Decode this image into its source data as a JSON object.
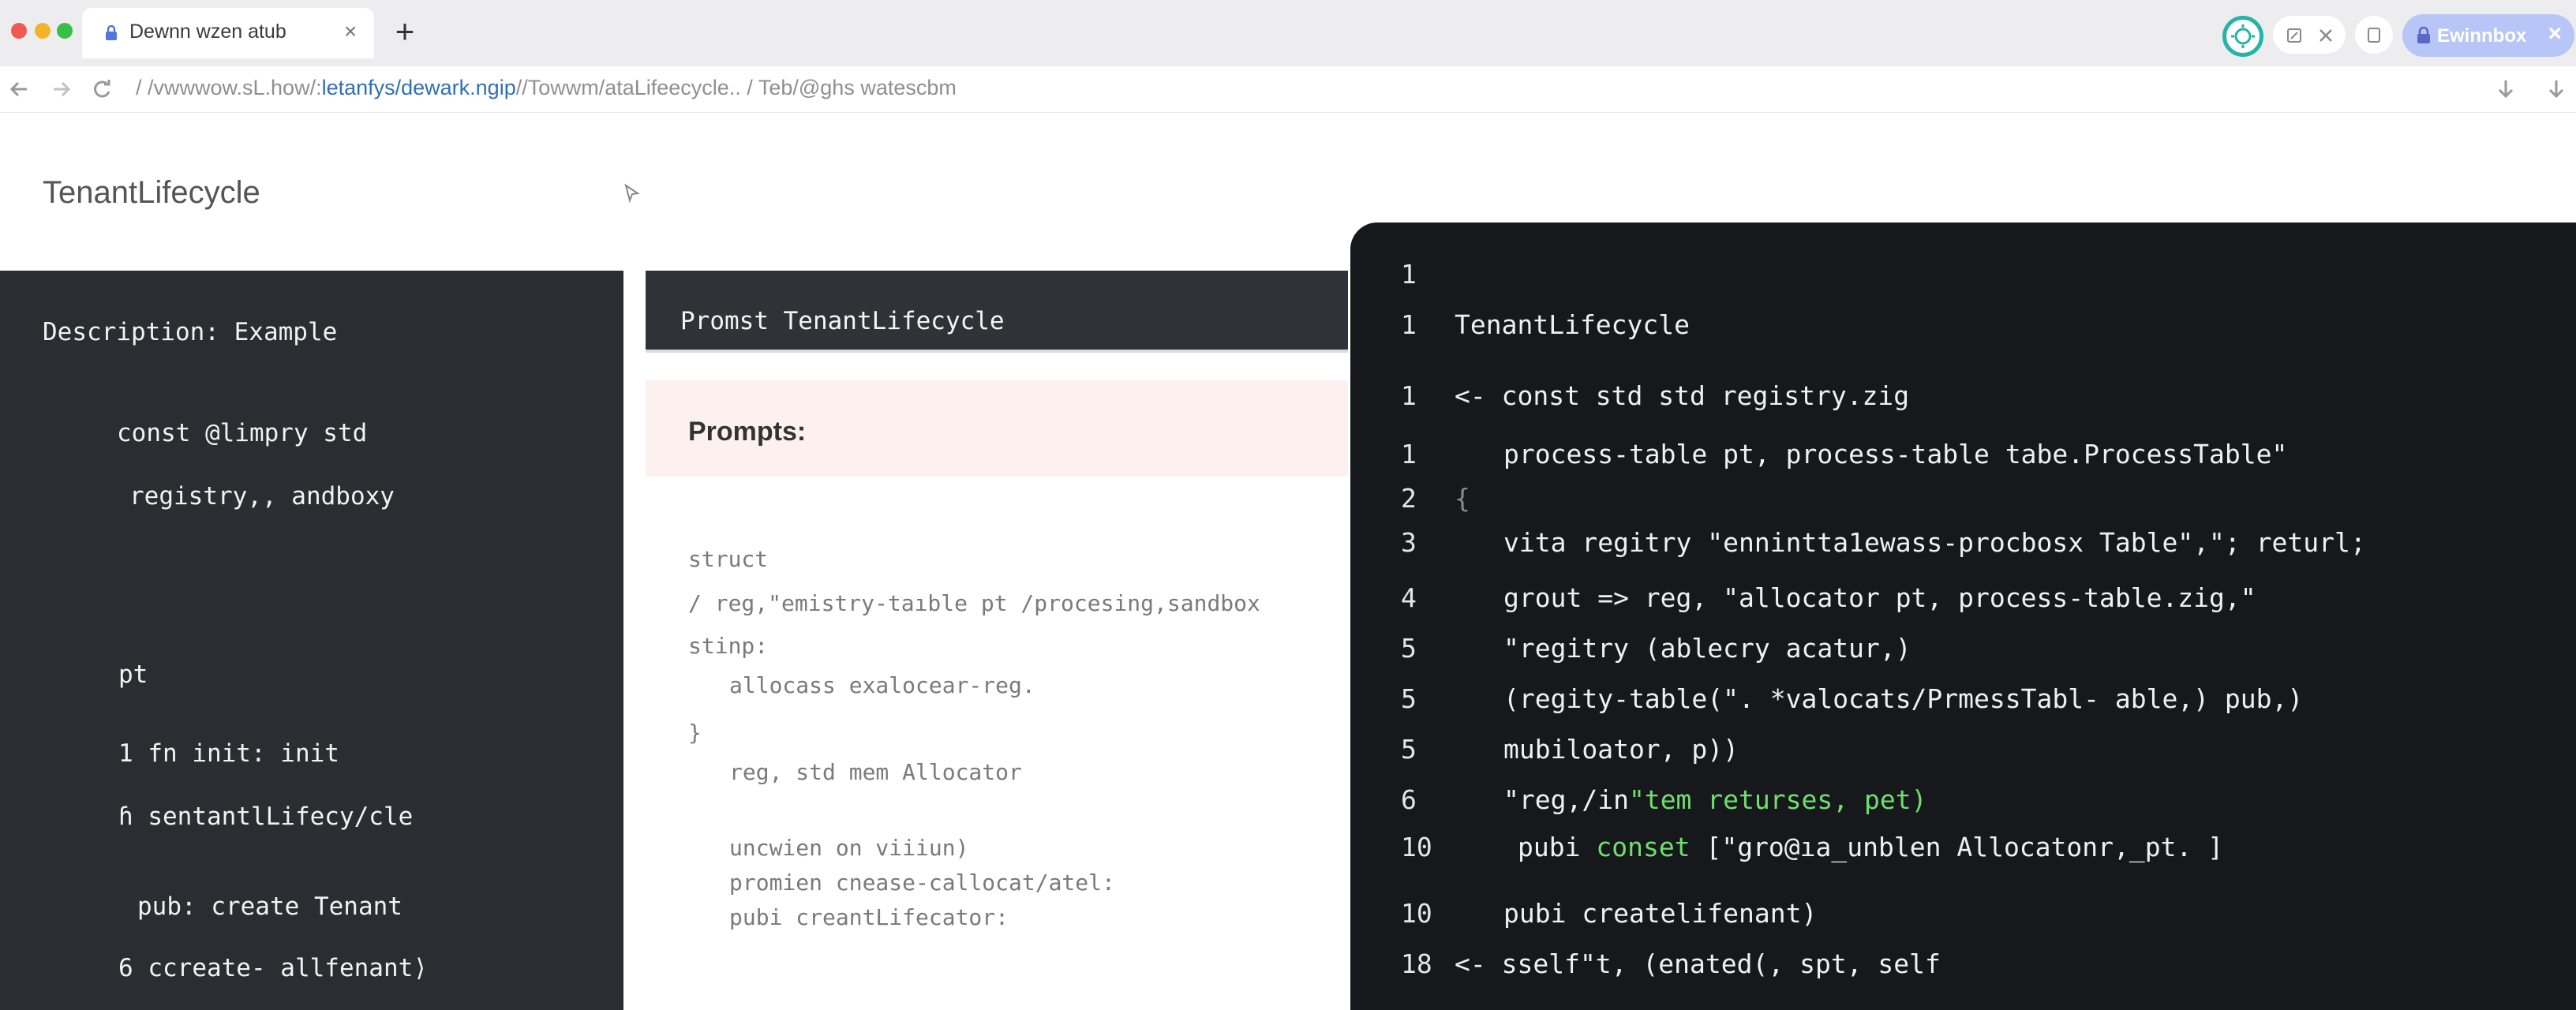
{
  "browser": {
    "tab_title": "Dewnn wzen atub",
    "tab_close": "×",
    "new_tab": "+",
    "inbox_label": "Ewinnbox",
    "inbox_close": "×",
    "url_prefix": "/ /vwwwow.sL.how/:",
    "url_highlight": "letanfys/dewark.ngip",
    "url_suffix": "//Towwm/ataLifeecycle.. / Teb/@ghs watescbm",
    "colors": {
      "accent_teal": "#25b5a6",
      "inbox_pill": "#b8c6f7",
      "link_blue": "#2f6fb6"
    }
  },
  "page": {
    "title": "TenantLifecycle"
  },
  "left_panel": {
    "lines": [
      "Description: Example",
      "const @limpry std",
      "registry,, andboxy",
      "pt",
      "1  fn init: init",
      "ɦ  sentantlLifecy/cle",
      "pub: create Tenant",
      "6  ccreate- allfenant⟩"
    ]
  },
  "middle_panel": {
    "header": "Promst TenantLifecycle",
    "prompts_label": "Prompts:",
    "lines": [
      "struct",
      "/   reg,\"emistry-taıble pt /procesing,sandbox",
      "stinp:",
      "allocass exalocear-reg.",
      "}",
      "reg, std mem Allocator",
      "uncwien on viiiun)",
      "promien cnease-callocat/atel:",
      "pubi creantLifecator:"
    ]
  },
  "code_panel": {
    "line_numbers": [
      "1",
      "1",
      "1",
      "1",
      "2",
      "3",
      "4",
      "5",
      "5",
      "5",
      "6",
      "10",
      "10",
      "18"
    ],
    "lines": [
      "",
      "TenantLifecycle",
      "<-  const std std registry.zig",
      "process-table pt, process-table tabe.ProcessTable\"",
      "{",
      "vita regitry \"ennintta1ewass-procbosx Table\",\"; returl;",
      "grout => reg, \"allocator pt, process-table.zig,\"",
      "\"regitry (ablecry acatur,)",
      "(regity-table(\". *valocats/PrmessTabl- able,) pub,)",
      "mubiloator, p))",
      "\"reg,/in",
      "pubi",
      "pubi createlifenant)",
      "<-  sself\"t, (enated(, spt, self"
    ],
    "line_10_tail": "\"tem returses, pet)",
    "line_11_keyword": "conset",
    "line_11_tail": "[\"gro@ıa_unblen Allocatonr,_pt. ]"
  }
}
